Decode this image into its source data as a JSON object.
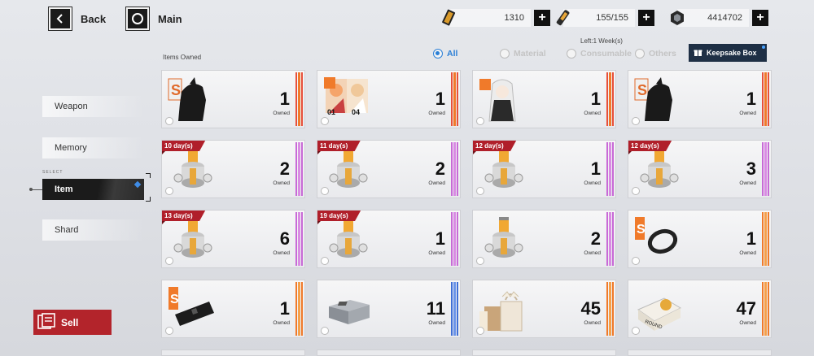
{
  "topbar": {
    "back_label": "Back",
    "main_label": "Main",
    "resources": [
      {
        "icon": "ticket-icon",
        "value": "1310"
      },
      {
        "icon": "stamina-icon",
        "value": "155/155"
      },
      {
        "icon": "coin-icon",
        "value": "4414702"
      }
    ]
  },
  "sidebar": {
    "select_tag": "SELECT",
    "items": [
      {
        "label": "Weapon",
        "active": false
      },
      {
        "label": "Memory",
        "active": false
      },
      {
        "label": "Item",
        "active": true
      },
      {
        "label": "Shard",
        "active": false
      }
    ],
    "sell_label": "Sell"
  },
  "filters": {
    "items_owned_label": "Items Owned",
    "left_week": "Left:1 Week(s)",
    "options": [
      {
        "label": "All",
        "selected": true
      },
      {
        "label": "Material",
        "selected": false
      },
      {
        "label": "Consumable",
        "selected": false
      },
      {
        "label": "Others",
        "selected": false
      }
    ],
    "keepsake_label": "Keepsake Box"
  },
  "colors": {
    "accent_blue": "#2a7fd6",
    "sell_red": "#b3242b",
    "rarity_orange": "#f07a2a",
    "rarity_red": "#e8503a",
    "rarity_purple": "#c86ad6",
    "rarity_blue": "#3f6fd6"
  },
  "owned_label": "Owned",
  "cards": [
    {
      "count": "1",
      "rarity": "red",
      "thumb": "weapon-silhouette-icon",
      "expiry": ""
    },
    {
      "count": "1",
      "rarity": "red",
      "thumb": "character-cards-icon",
      "expiry": "",
      "tags": [
        "01",
        "04"
      ]
    },
    {
      "count": "1",
      "rarity": "red",
      "thumb": "character-portrait-icon",
      "expiry": ""
    },
    {
      "count": "1",
      "rarity": "red",
      "thumb": "weapon-silhouette-icon",
      "expiry": ""
    },
    {
      "count": "2",
      "rarity": "purple",
      "thumb": "capsule-icon",
      "expiry": "10 day(s)"
    },
    {
      "count": "2",
      "rarity": "purple",
      "thumb": "capsule-icon",
      "expiry": "11 day(s)"
    },
    {
      "count": "1",
      "rarity": "purple",
      "thumb": "capsule-icon",
      "expiry": "12 day(s)"
    },
    {
      "count": "3",
      "rarity": "purple",
      "thumb": "capsule-icon",
      "expiry": "12 day(s)"
    },
    {
      "count": "6",
      "rarity": "purple",
      "thumb": "capsule-icon",
      "expiry": "13 day(s)"
    },
    {
      "count": "1",
      "rarity": "purple",
      "thumb": "capsule-icon",
      "expiry": "19 day(s)"
    },
    {
      "count": "2",
      "rarity": "purple",
      "thumb": "capsule-icon",
      "expiry": ""
    },
    {
      "count": "1",
      "rarity": "orange",
      "thumb": "ring-icon",
      "expiry": ""
    },
    {
      "count": "1",
      "rarity": "orange",
      "thumb": "black-case-icon",
      "expiry": ""
    },
    {
      "count": "11",
      "rarity": "blue",
      "thumb": "metal-case-icon",
      "expiry": ""
    },
    {
      "count": "45",
      "rarity": "orange",
      "thumb": "gift-bags-icon",
      "expiry": ""
    },
    {
      "count": "47",
      "rarity": "orange",
      "thumb": "gift-box-icon",
      "expiry": ""
    }
  ]
}
